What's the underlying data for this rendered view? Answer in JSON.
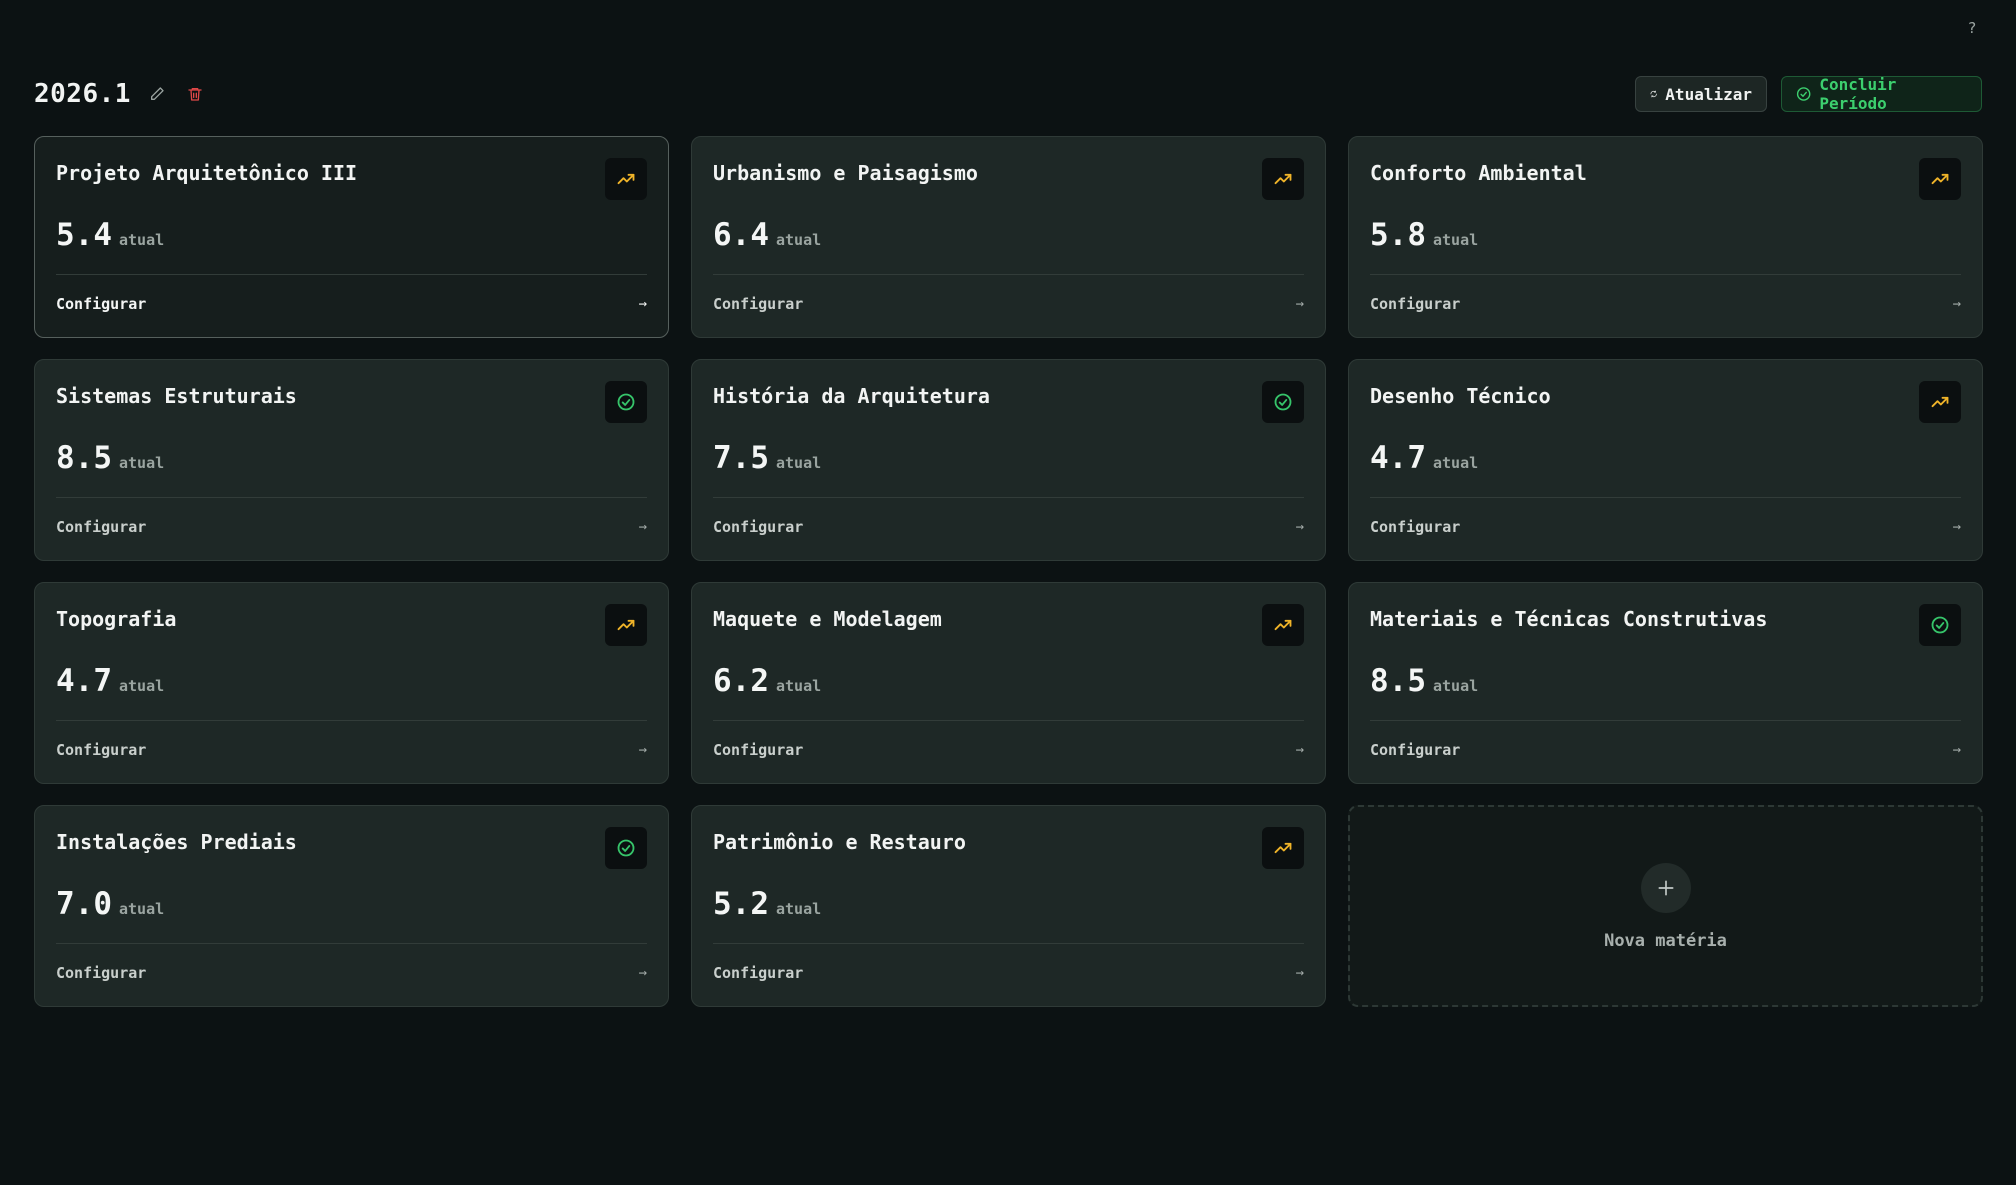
{
  "help": {
    "label": "?"
  },
  "header": {
    "period_title": "2026.1",
    "refresh_label": "Atualizar",
    "finish_label": "Concluir Período"
  },
  "colors": {
    "background": "#0c1213",
    "card": "#1e2826",
    "trend_icon": "#f0b429",
    "check_icon": "#36c46a",
    "delete_icon": "#e04848",
    "finish_accent": "#3ccf6e"
  },
  "cards": [
    {
      "title": "Projeto Arquitetônico III",
      "grade": "5.4",
      "suffix": "atual",
      "configure": "Configurar",
      "status_icon": "trending-up-icon"
    },
    {
      "title": "Urbanismo e Paisagismo",
      "grade": "6.4",
      "suffix": "atual",
      "configure": "Configurar",
      "status_icon": "trending-up-icon"
    },
    {
      "title": "Conforto Ambiental",
      "grade": "5.8",
      "suffix": "atual",
      "configure": "Configurar",
      "status_icon": "trending-up-icon"
    },
    {
      "title": "Sistemas Estruturais",
      "grade": "8.5",
      "suffix": "atual",
      "configure": "Configurar",
      "status_icon": "check-circle-icon"
    },
    {
      "title": "História da Arquitetura",
      "grade": "7.5",
      "suffix": "atual",
      "configure": "Configurar",
      "status_icon": "check-circle-icon"
    },
    {
      "title": "Desenho Técnico",
      "grade": "4.7",
      "suffix": "atual",
      "configure": "Configurar",
      "status_icon": "trending-up-icon"
    },
    {
      "title": "Topografia",
      "grade": "4.7",
      "suffix": "atual",
      "configure": "Configurar",
      "status_icon": "trending-up-icon"
    },
    {
      "title": "Maquete e Modelagem",
      "grade": "6.2",
      "suffix": "atual",
      "configure": "Configurar",
      "status_icon": "trending-up-icon"
    },
    {
      "title": "Materiais e Técnicas Construtivas",
      "grade": "8.5",
      "suffix": "atual",
      "configure": "Configurar",
      "status_icon": "check-circle-icon"
    },
    {
      "title": "Instalações Prediais",
      "grade": "7.0",
      "suffix": "atual",
      "configure": "Configurar",
      "status_icon": "check-circle-icon"
    },
    {
      "title": "Patrimônio e Restauro",
      "grade": "5.2",
      "suffix": "atual",
      "configure": "Configurar",
      "status_icon": "trending-up-icon"
    }
  ],
  "add_card": {
    "label": "Nova matéria"
  }
}
